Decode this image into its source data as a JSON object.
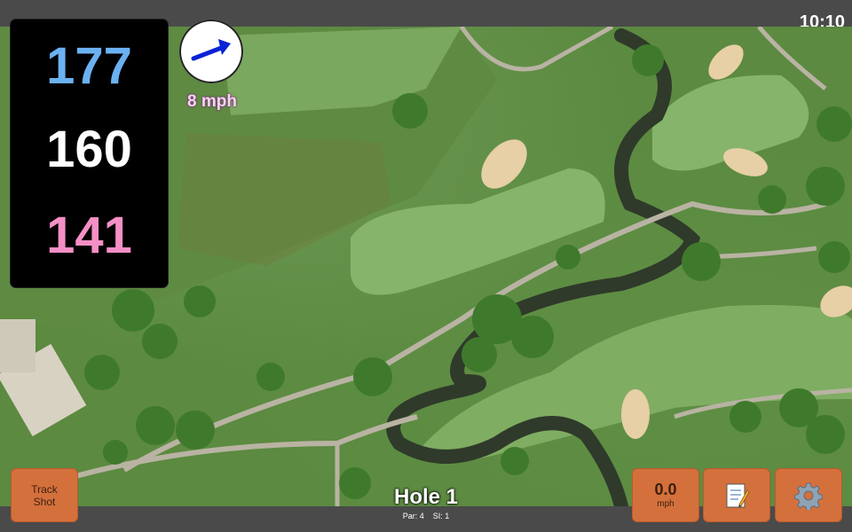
{
  "status": {
    "time": "10:10"
  },
  "distances": {
    "back": "177",
    "middle": "160",
    "front": "141"
  },
  "colors": {
    "back": "#6bb1f1",
    "middle": "#ffffff",
    "front": "#f58fc6",
    "accent": "#d4703c"
  },
  "wind": {
    "speed_label": "8 mph",
    "icon": "arrow-icon"
  },
  "hole": {
    "title": "Hole 1",
    "par_label": "Par: 4",
    "si_label": "SI: 1"
  },
  "buttons": {
    "track_shot_line1": "Track",
    "track_shot_line2": "Shot",
    "speed_value": "0.0",
    "speed_unit": "mph",
    "notes_icon": "notepad-icon",
    "settings_icon": "gear-icon"
  }
}
